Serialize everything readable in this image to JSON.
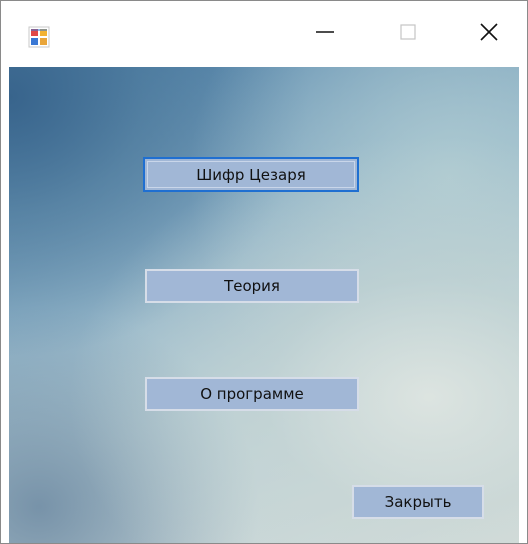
{
  "window": {
    "icon": "app-window-icon",
    "controls": {
      "minimize_icon": "minimize-icon",
      "maximize_icon": "maximize-icon",
      "close_icon": "close-icon"
    }
  },
  "buttons": {
    "caesar": "Шифр Цезаря",
    "theory": "Теория",
    "about": "О программе",
    "close": "Закрыть"
  },
  "colors": {
    "button_fill": "#a1b7d6",
    "focus_border": "#1f6fd1"
  }
}
